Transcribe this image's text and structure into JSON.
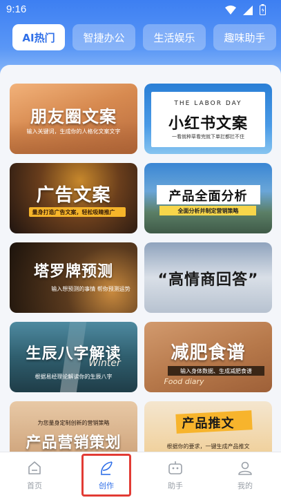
{
  "status_bar": {
    "time": "9:16"
  },
  "tabs": [
    {
      "label": "AI热门",
      "active": true
    },
    {
      "label": "智捷办公",
      "active": false
    },
    {
      "label": "生活娱乐",
      "active": false
    },
    {
      "label": "趣味助手",
      "active": false
    }
  ],
  "cards": [
    {
      "title": "朋友圈文案",
      "subtitle": "输入关键词，生成你的人格化文案文字",
      "theme": "#c97a45"
    },
    {
      "title": "小红书文案",
      "subtitle": "一看就种草看完就下单拦都拦不住",
      "header": "THE LABOR DAY",
      "theme": "#ffffff"
    },
    {
      "title": "广告文案",
      "subtitle": "量身打造广告文案，轻松吸睛推广",
      "theme": "#2b2118"
    },
    {
      "title": "产品全面分析",
      "subtitle": "全面分析并制定营销策略",
      "theme": "#3a6ea5"
    },
    {
      "title": "塔罗牌预测",
      "subtitle": "输入想预测的事情 帮你预测运势",
      "theme": "#2a1c12"
    },
    {
      "title": "“高情商回答”",
      "subtitle": "",
      "theme": "#c4ccd8"
    },
    {
      "title": "生辰八字解读",
      "subtitle": "根据易经理论解读你的生辰八字",
      "script": "Winter",
      "theme": "#2c5f6b"
    },
    {
      "title": "减肥食谱",
      "subtitle": "输入身体数据、生成减肥食谱",
      "script": "Food diary",
      "theme": "#b9774a"
    },
    {
      "title": "产品营销策划",
      "subtitle": "为您量身定制创新的营销策略",
      "theme": "#caa07a"
    },
    {
      "title": "产品推文",
      "subtitle": "根据你的要求，一键生成产品推文",
      "theme": "#e8a33a"
    }
  ],
  "bottom_nav": [
    {
      "label": "首页",
      "icon": "home-icon",
      "active": false
    },
    {
      "label": "创作",
      "icon": "feather-pen-icon",
      "active": true
    },
    {
      "label": "助手",
      "icon": "robot-icon",
      "active": false
    },
    {
      "label": "我的",
      "icon": "user-icon",
      "active": false
    }
  ],
  "colors": {
    "primary": "#2f6fe8",
    "highlight": "#e23b34"
  }
}
